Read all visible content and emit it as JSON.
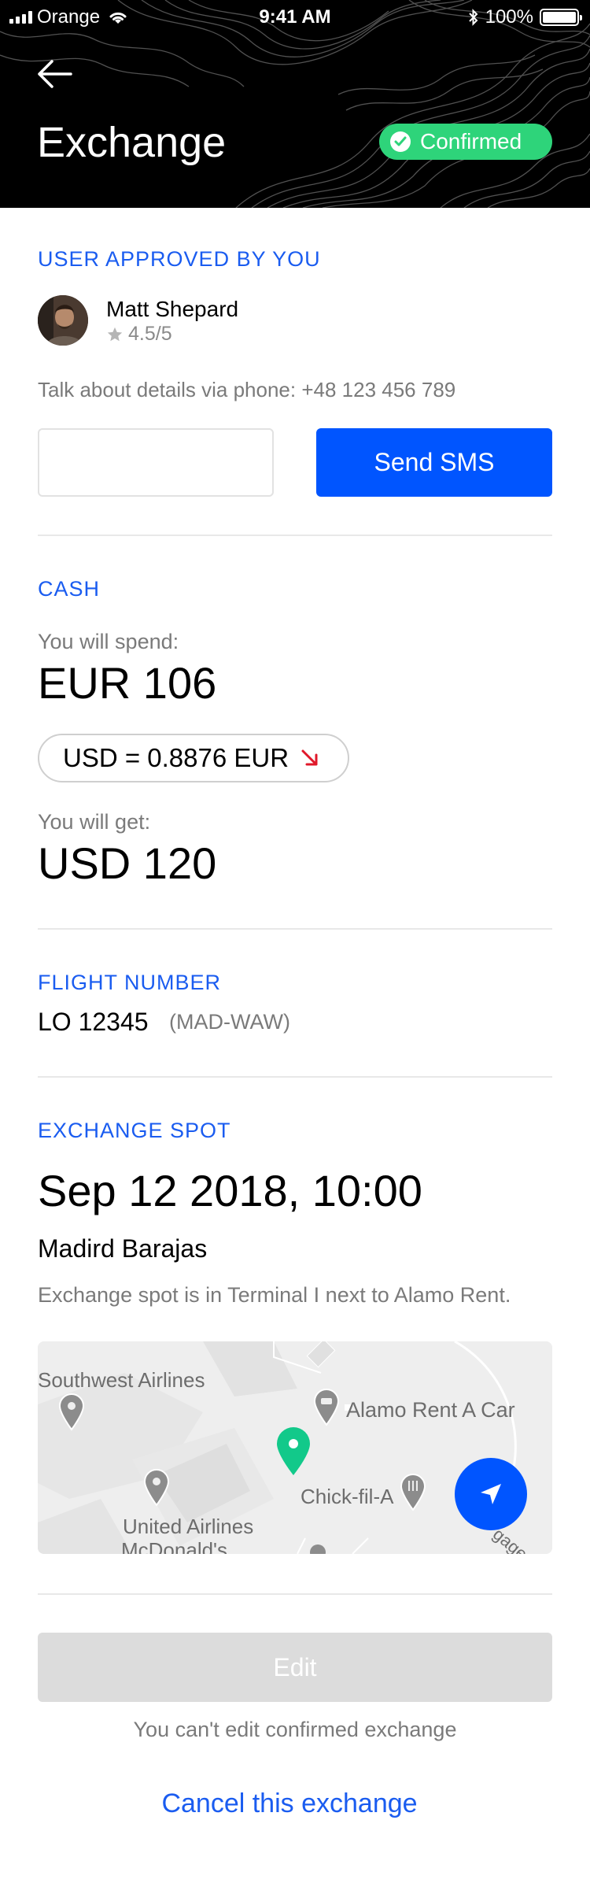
{
  "status_bar": {
    "carrier": "Orange",
    "time": "9:41 AM",
    "battery": "100%"
  },
  "header": {
    "title": "Exchange",
    "status_badge": "Confirmed"
  },
  "user_section": {
    "label": "USER APPROVED BY YOU",
    "name": "Matt Shepard",
    "rating": "4.5/5",
    "phone_text": "Talk about details via phone: +48 123 456 789",
    "sms_input_value": "",
    "sms_button": "Send SMS"
  },
  "cash_section": {
    "label": "CASH",
    "spend_label": "You will spend:",
    "spend_value": "EUR 106",
    "rate": "USD = 0.8876 EUR",
    "get_label": "You will get:",
    "get_value": "USD 120"
  },
  "flight_section": {
    "label": "FLIGHT NUMBER",
    "number": "LO 12345",
    "route": "(MAD-WAW)"
  },
  "spot_section": {
    "label": "EXCHANGE SPOT",
    "datetime": "Sep 12 2018, 10:00",
    "place": "Madird Barajas",
    "description": "Exchange spot is in Terminal I next to Alamo Rent."
  },
  "map": {
    "labels": {
      "southwest": "Southwest Airlines",
      "alamo": "Alamo Rent A Car",
      "chick": "Chick-fil-A",
      "united": "United Airlines",
      "mcdonalds": "McDonald's",
      "baggage": "gage s"
    }
  },
  "actions": {
    "edit_button": "Edit",
    "edit_note": "You can't edit confirmed exchange",
    "cancel_link": "Cancel this exchange"
  },
  "colors": {
    "accent": "#0055ff",
    "label_blue": "#1a5cf0",
    "confirmed_green": "#2ed47a",
    "map_pin_green": "#12c98a",
    "rate_down_red": "#e0182a"
  },
  "icons": [
    "back-arrow-icon",
    "check-icon",
    "star-icon",
    "rate-down-arrow-icon",
    "map-pin-icon",
    "navigate-icon",
    "wifi-icon",
    "bluetooth-icon"
  ]
}
